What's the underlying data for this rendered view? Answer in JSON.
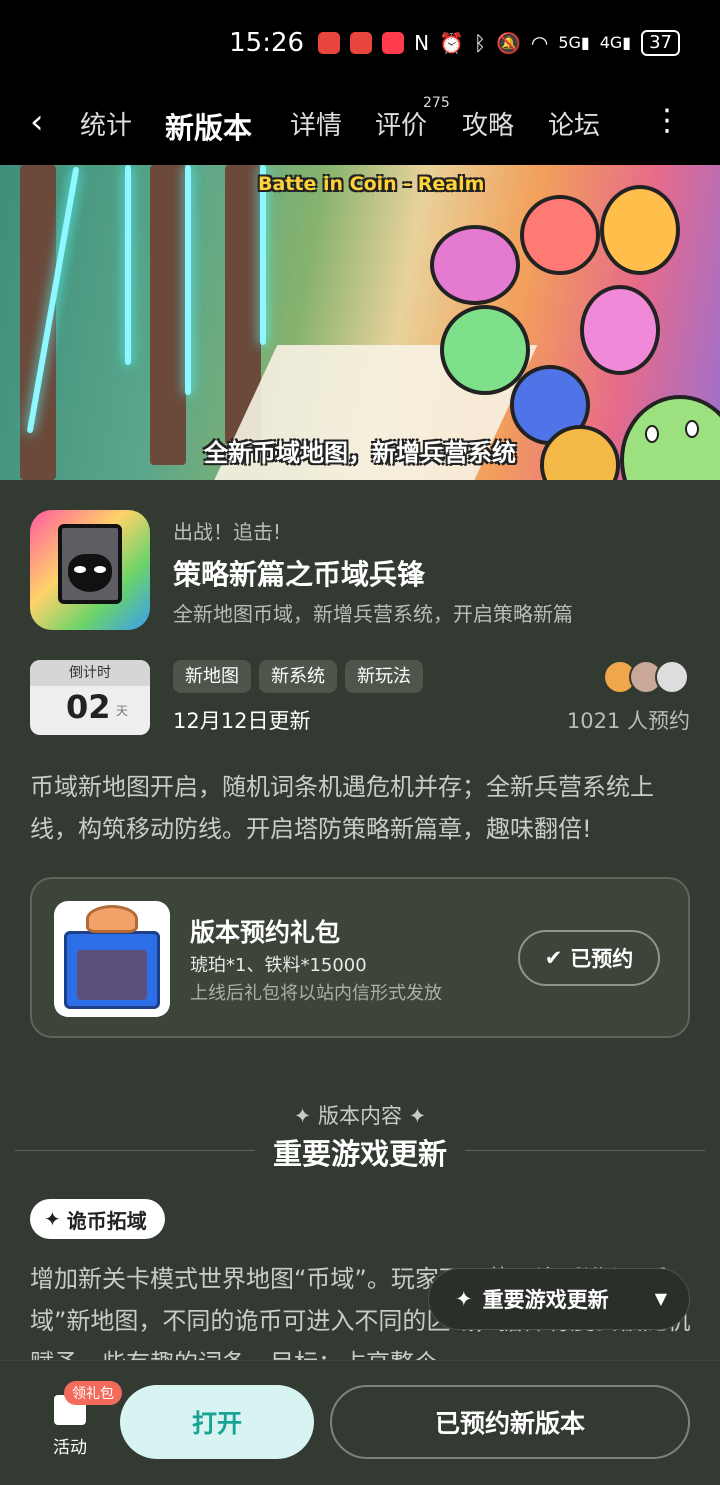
{
  "status_bar": {
    "time": "15:26",
    "icons": [
      "weibo-app-icon",
      "huawei-app-icon",
      "xiaohongshu-app-icon",
      "nfc-icon",
      "alarm-icon",
      "bluetooth-icon",
      "mute-icon",
      "wifi-icon",
      "signal-5g-icon",
      "signal-4g-icon"
    ],
    "battery": "37"
  },
  "nav": {
    "tabs": [
      "统计",
      "新版本",
      "详情",
      "评价",
      "攻略",
      "论坛"
    ],
    "active_tab": "新版本",
    "review_count": "275"
  },
  "banner": {
    "game_logo_text": "Batte in Coin - Realm",
    "caption": "全新币域地图，新增兵营系统"
  },
  "version": {
    "slogan": "出战！追击!",
    "title": "策略新篇之币域兵锋",
    "subtitle": "全新地图币域，新增兵营系统，开启策略新篇",
    "countdown_label": "倒计时",
    "countdown_value": "02",
    "countdown_unit": "天",
    "tags": [
      "新地图",
      "新系统",
      "新玩法"
    ],
    "update_date": "12月12日更新",
    "reservations": "1021 人预约",
    "description": "币域新地图开启，随机词条机遇危机并存；全新兵营系统上线，构筑移动防线。开启塔防策略新篇章，趣味翻倍!"
  },
  "gift": {
    "title": "版本预约礼包",
    "items": "琥珀*1、铁料*15000",
    "note": "上线后礼包将以站内信形式发放",
    "button": "已预约"
  },
  "content": {
    "section_label": "版本内容",
    "section_title": "重要游戏更新",
    "pill_label": "诡币拓域",
    "body": "增加新关卡模式世界地图“币域”。玩家可以使用诡币进入“币域”新地图，不同的诡币可进入不同的区域，据稀有度会被随机赋予一些有趣的词条。目标：占高整个",
    "float_nav": "重要游戏更新"
  },
  "bottom_bar": {
    "activity_label": "活动",
    "activity_badge": "领礼包",
    "open_button": "打开",
    "reserve_button": "已预约新版本"
  },
  "colors": {
    "background": "#323a31",
    "accent": "#2ab6a8",
    "open_button_bg": "#d7f4f2",
    "badge": "#f26b5b"
  }
}
